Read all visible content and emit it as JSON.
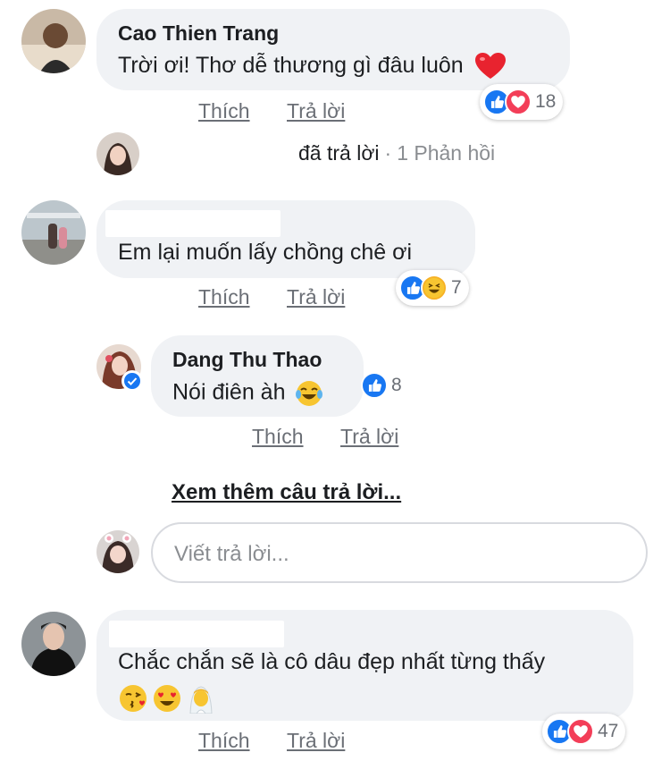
{
  "comments": [
    {
      "author": "Cao Thien Trang",
      "text": "Trời ơi! Thơ dễ thương gì đâu luôn",
      "emoji": "heart",
      "reactions": [
        "like",
        "love"
      ],
      "reaction_count": "18"
    },
    {
      "author": "",
      "text": "Em lại muốn lấy chồng chê ơi",
      "reactions": [
        "like",
        "haha"
      ],
      "reaction_count": "7"
    },
    {
      "author": "",
      "text": "Chắc chắn sẽ là cô dâu đẹp nhất từng thấy",
      "emoji_line": [
        "kissing-heart",
        "heart-eyes",
        "bride"
      ],
      "reactions": [
        "like",
        "love"
      ],
      "reaction_count": "47"
    }
  ],
  "reply_summary": {
    "action": "đã trả lời",
    "separator": "·",
    "count_text": "1 Phản hồi"
  },
  "reply": {
    "author": "Dang Thu Thao",
    "text": "Nói điên àh",
    "emoji": "joy",
    "reactions": [
      "like"
    ],
    "reaction_count": "8"
  },
  "actions": {
    "like": "Thích",
    "reply": "Trả lời"
  },
  "more_replies": "Xem thêm câu trả lời...",
  "reply_input": {
    "placeholder": "Viết trả lời..."
  },
  "colors": {
    "like_blue": "#1877f2",
    "love_red": "#f33e58",
    "bubble_bg": "#f0f2f5",
    "meta_gray": "#6b6f76"
  }
}
